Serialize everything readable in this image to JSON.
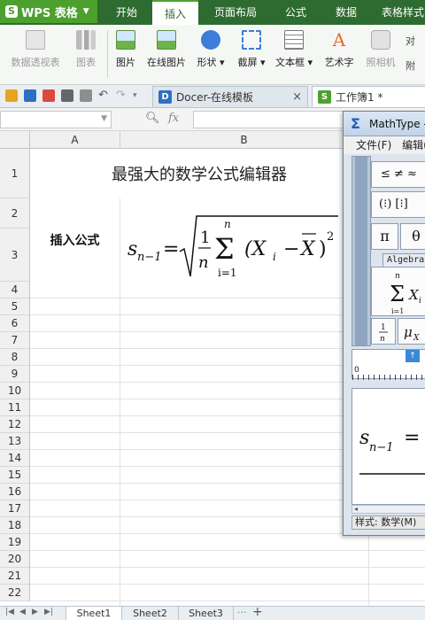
{
  "app": {
    "name": "WPS 表格"
  },
  "menu": {
    "tabs": [
      "开始",
      "插入",
      "页面布局",
      "公式",
      "数据",
      "表格样式"
    ],
    "active": "插入"
  },
  "ribbon": {
    "buttons": [
      {
        "label": "数据透视表",
        "icon": "pivot-table-icon",
        "enabled": false
      },
      {
        "label": "图表",
        "icon": "chart-icon",
        "enabled": false
      },
      {
        "label": "图片",
        "icon": "picture-icon",
        "enabled": true
      },
      {
        "label": "在线图片",
        "icon": "online-picture-icon",
        "enabled": true
      },
      {
        "label": "形状 ▾",
        "icon": "shape-icon",
        "enabled": true
      },
      {
        "label": "截屏 ▾",
        "icon": "screenshot-icon",
        "enabled": true
      },
      {
        "label": "文本框 ▾",
        "icon": "textbox-icon",
        "enabled": true
      },
      {
        "label": "艺术字",
        "icon": "wordart-icon",
        "enabled": true
      },
      {
        "label": "照相机",
        "icon": "camera-icon",
        "enabled": false
      }
    ],
    "small": [
      "对",
      "附"
    ]
  },
  "doc_tabs": [
    {
      "label": "Docer-在线模板",
      "icon": "D",
      "close": "×"
    },
    {
      "label": "工作簿1 *",
      "icon": "S"
    }
  ],
  "formula_bar": {
    "name_box": "",
    "fx": "fx",
    "content": ""
  },
  "grid": {
    "columns": [
      "A",
      "B"
    ],
    "rows": [
      "1",
      "2",
      "3",
      "4",
      "5",
      "6",
      "7",
      "8",
      "9",
      "10",
      "11",
      "12",
      "13",
      "14",
      "15",
      "16",
      "17",
      "18",
      "19",
      "20",
      "21",
      "22"
    ],
    "title_cell": "最强大的数学公式编辑器",
    "label_cell": "插入公式",
    "formula": {
      "s": "s",
      "sub": "n−1",
      "eq": "=",
      "frac_num": "1",
      "frac_den": "n",
      "sum_top": "n",
      "sum_bot": "i=1",
      "term": "(X",
      "term_sub": "i",
      "minus": "−",
      "xbar": "X",
      "close": ")",
      "power": "2"
    }
  },
  "sheets": {
    "tabs": [
      "Sheet1",
      "Sheet2",
      "Sheet3"
    ],
    "active": "Sheet1",
    "more": "···",
    "add": "+"
  },
  "mathtype": {
    "title": "MathType -",
    "menu": [
      "文件(F)",
      "编辑("
    ],
    "palette": {
      "row1": "≤ ≠ ≈",
      "row2": "(⁝) [⁝]",
      "pi": "π",
      "theta": "θ",
      "tab": "Algebra",
      "sum_x": "X",
      "sum_x_sub": "i",
      "sum_top": "n",
      "sum_bot": "i=1",
      "frac_num": "1",
      "frac_den": "n",
      "mu": "μ",
      "mu_sub": "X"
    },
    "ruler": {
      "zero": "0"
    },
    "editor": {
      "s": "s",
      "sub": "n−1",
      "eq": "="
    },
    "status": "样式: 数学(M)"
  }
}
